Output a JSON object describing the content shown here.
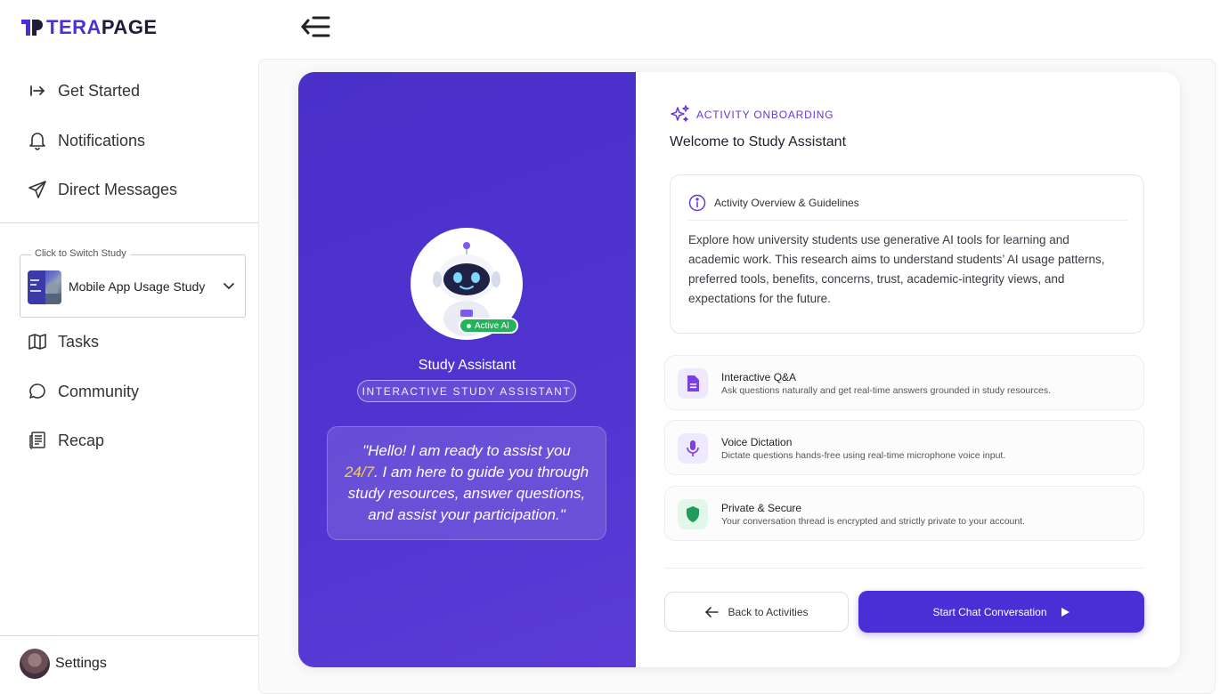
{
  "brand": {
    "part1": "TERA",
    "part2": "PAGE"
  },
  "nav_top": [
    {
      "label": "Get Started",
      "icon": "arrow-right-to-bar-icon"
    },
    {
      "label": "Notifications",
      "icon": "bell-icon"
    },
    {
      "label": "Direct Messages",
      "icon": "send-icon"
    }
  ],
  "study_switch": {
    "label": "Click to Switch Study",
    "current": "Mobile App Usage Study"
  },
  "nav_bottom": [
    {
      "label": "Tasks",
      "icon": "map-icon"
    },
    {
      "label": "Community",
      "icon": "chat-bubble-icon"
    },
    {
      "label": "Recap",
      "icon": "newspaper-icon"
    }
  ],
  "settings": {
    "label": "Settings"
  },
  "assistant": {
    "badge": "Active AI",
    "name": "Study Assistant",
    "tag": "INTERACTIVE STUDY ASSISTANT",
    "quote_a": "\"Hello! I am ready to assist you ",
    "quote_highlight": "24/7",
    "quote_b": ". I am here to guide you through study resources, answer questions, and assist your participation.\""
  },
  "onboarding": {
    "eyebrow": "ACTIVITY ONBOARDING",
    "title": "Welcome to Study Assistant",
    "overview_title": "Activity Overview & Guidelines",
    "overview_body": "Explore how university students use generative AI tools for learning and academic work. This research aims to understand students’ AI usage patterns, preferred tools, benefits, concerns, trust, academic-integrity views, and expectations for the future."
  },
  "features": [
    {
      "title": "Interactive Q&A",
      "desc": "Ask questions naturally and get real-time answers grounded in study resources.",
      "icon": "document-icon"
    },
    {
      "title": "Voice Dictation",
      "desc": "Dictate questions hands-free using real-time microphone voice input.",
      "icon": "microphone-icon"
    },
    {
      "title": "Private & Secure",
      "desc": "Your conversation thread is encrypted and strictly private to your account.",
      "icon": "shield-icon"
    }
  ],
  "actions": {
    "back": "Back to Activities",
    "start": "Start Chat Conversation"
  },
  "colors": {
    "brand": "#4a2fd6",
    "accent_purple": "#6b35d9",
    "success": "#22b35c",
    "highlight": "#f7d13f"
  }
}
